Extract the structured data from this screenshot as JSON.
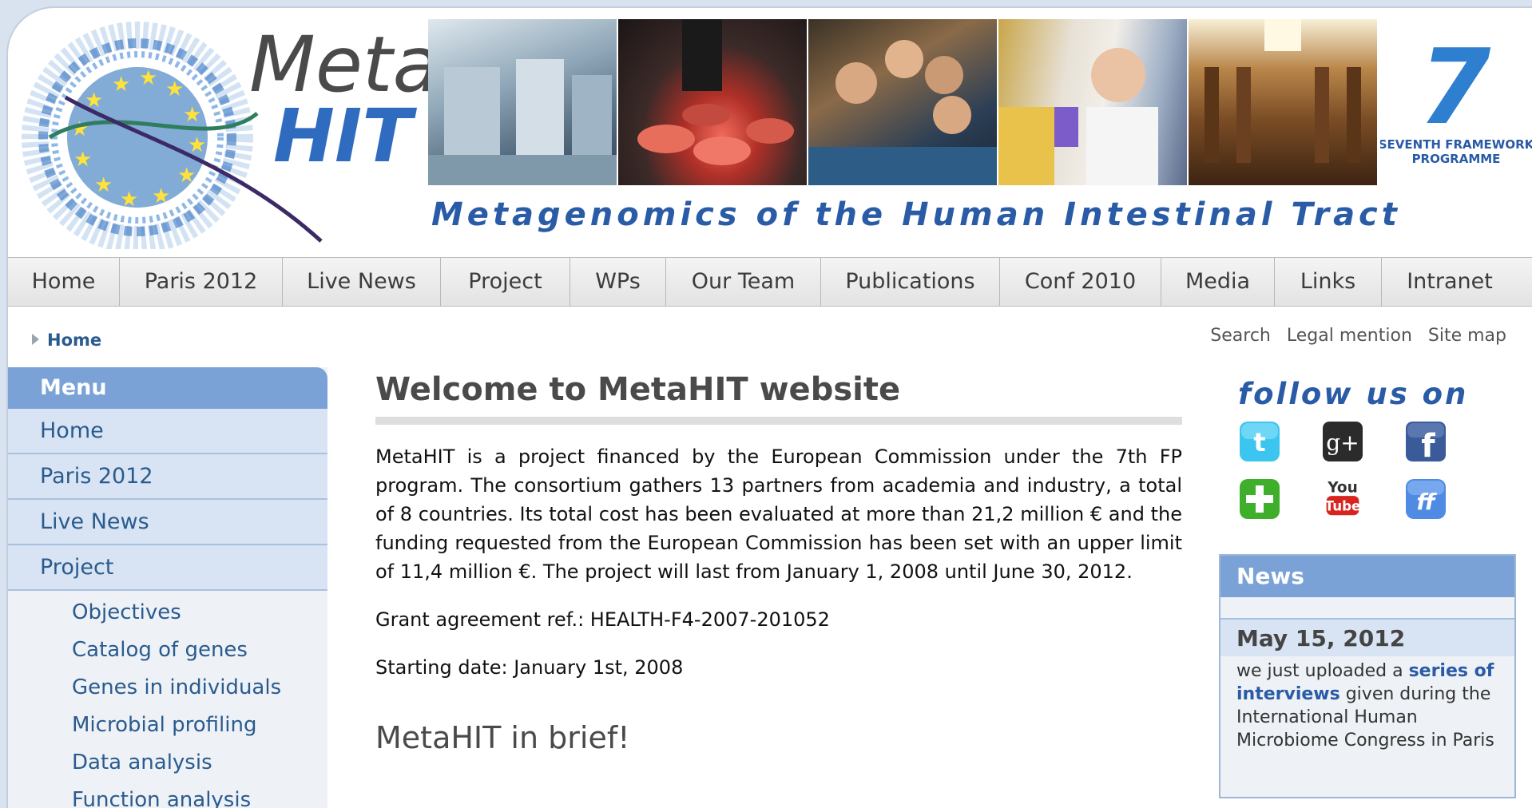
{
  "header": {
    "logo_text_meta": "Meta",
    "logo_text_hit": "HIT",
    "tagline": "Metagenomics of the Human Intestinal Tract",
    "fp7_line1": "SEVENTH FRAMEWORK",
    "fp7_line2": "PROGRAMME",
    "fp7_digit": "7"
  },
  "topnav": {
    "items": [
      "Home",
      "Paris 2012",
      "Live News",
      "Project",
      "WPs",
      "Our Team",
      "Publications",
      "Conf 2010",
      "Media",
      "Links",
      "Intranet"
    ]
  },
  "breadcrumb": {
    "current": "Home"
  },
  "utility_links": {
    "search": "Search",
    "legal": "Legal mention",
    "sitemap": "Site map"
  },
  "sidebar": {
    "title": "Menu",
    "items": [
      "Home",
      "Paris 2012",
      "Live News",
      "Project"
    ],
    "project_subitems": [
      "Objectives",
      "Catalog of genes",
      "Genes in individuals",
      "Microbial profiling",
      "Data analysis",
      "Function analysis"
    ]
  },
  "main": {
    "title": "Welcome to MetaHIT website",
    "intro": "MetaHIT is a project financed by the European Commission under the 7th FP program. The consortium gathers 13 partners from academia and industry, a total of 8 countries. Its total cost has been evaluated at more than 21,2 million € and the funding requested from the European Commission has been set with an upper limit of 11,4 million €. The project will last from January 1, 2008 until June 30, 2012.",
    "grant": "Grant agreement ref.: HEALTH-F4-2007-201052",
    "start": "Starting date: January 1st, 2008",
    "section_title": "MetaHIT in brief!"
  },
  "follow": {
    "title": "follow us on",
    "icons": [
      "twitter-icon",
      "google-plus-icon",
      "facebook-icon",
      "add-icon",
      "youtube-icon",
      "friendfeed-icon"
    ],
    "youtube_top": "You",
    "youtube_bottom": "Tube",
    "gplus_text": "g+"
  },
  "news": {
    "title": "News",
    "date": "May 15, 2012",
    "text_before": "we just uploaded a",
    "link": "series of interviews",
    "text_after": "given during the International Human Microbiome Congress in Paris"
  },
  "colors": {
    "brand_blue": "#2a5ba6",
    "menu_blue": "#7aa2d6",
    "link_blue": "#2a5b8e"
  }
}
